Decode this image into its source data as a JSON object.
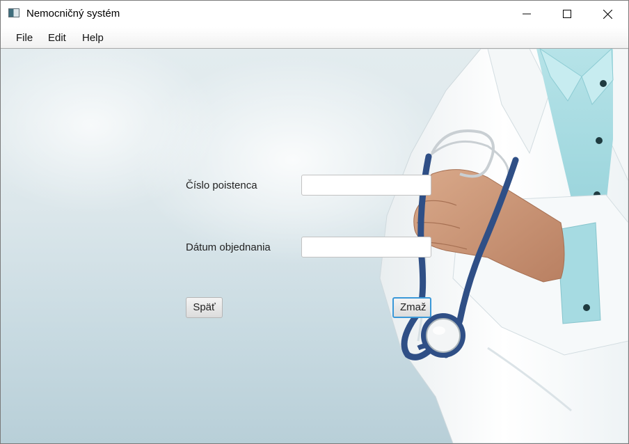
{
  "window": {
    "title": "Nemocničný systém"
  },
  "menu": {
    "items": [
      {
        "label": "File"
      },
      {
        "label": "Edit"
      },
      {
        "label": "Help"
      }
    ]
  },
  "form": {
    "insured_number_label": "Číslo poistenca",
    "insured_number_value": "",
    "appointment_date_label": "Dátum objednania",
    "appointment_date_value": "",
    "back_button_label": "Späť",
    "clear_button_label": "Zmaž"
  },
  "colors": {
    "focus_border": "#3a98d8",
    "stethoscope": "#2f4f86",
    "scrub_teal": "#a9dbe2"
  }
}
